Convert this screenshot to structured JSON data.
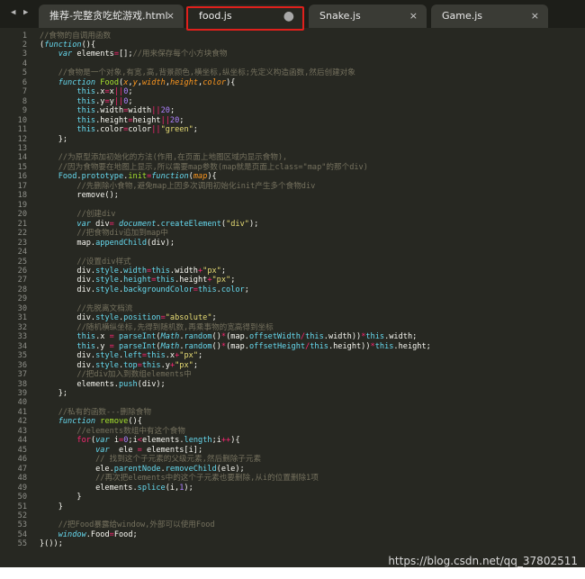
{
  "tabs": [
    {
      "label": "推荐-完整贪吃蛇游戏.html",
      "marker": "×",
      "active": false
    },
    {
      "label": "food.js",
      "marker": "●",
      "active": true
    },
    {
      "label": "Snake.js",
      "marker": "×",
      "active": false
    },
    {
      "label": "Game.js",
      "marker": "×",
      "active": false
    }
  ],
  "nav": {
    "back": "◀",
    "forward": "▶"
  },
  "line_numbers": [
    "1",
    "2",
    "3",
    "4",
    "5",
    "6",
    "7",
    "8",
    "9",
    "10",
    "11",
    "12",
    "13",
    "14",
    "15",
    "16",
    "17",
    "18",
    "19",
    "20",
    "21",
    "22",
    "23",
    "24",
    "25",
    "26",
    "27",
    "28",
    "29",
    "30",
    "31",
    "32",
    "33",
    "34",
    "35",
    "36",
    "37",
    "38",
    "39",
    "40",
    "41",
    "42",
    "43",
    "44",
    "45",
    "46",
    "47",
    "48",
    "49",
    "50",
    "51",
    "52",
    "53",
    "54",
    "55"
  ],
  "code": [
    [
      {
        "t": "//食物的自调用函数",
        "c": "c"
      }
    ],
    [
      {
        "t": "(",
        "c": ""
      },
      {
        "t": "function",
        "c": "k"
      },
      {
        "t": "(){",
        "c": ""
      }
    ],
    [
      {
        "t": "    ",
        "c": ""
      },
      {
        "t": "var",
        "c": "k"
      },
      {
        "t": " elements",
        "c": ""
      },
      {
        "t": "=",
        "c": "o"
      },
      {
        "t": "[];",
        "c": ""
      },
      {
        "t": "//用来保存每个小方块食物",
        "c": "c"
      }
    ],
    [],
    [
      {
        "t": "    ",
        "c": ""
      },
      {
        "t": "//食物是一个对象,有宽,高,背景颜色,横坐标,纵坐标;先定义构造函数,然后创建对象",
        "c": "c"
      }
    ],
    [
      {
        "t": "    ",
        "c": ""
      },
      {
        "t": "function",
        "c": "k"
      },
      {
        "t": " ",
        "c": ""
      },
      {
        "t": "Food",
        "c": "f"
      },
      {
        "t": "(",
        "c": ""
      },
      {
        "t": "x",
        "c": "p"
      },
      {
        "t": ",",
        "c": ""
      },
      {
        "t": "y",
        "c": "p"
      },
      {
        "t": ",",
        "c": ""
      },
      {
        "t": "width",
        "c": "p"
      },
      {
        "t": ",",
        "c": ""
      },
      {
        "t": "height",
        "c": "p"
      },
      {
        "t": ",",
        "c": ""
      },
      {
        "t": "color",
        "c": "p"
      },
      {
        "t": "){",
        "c": ""
      }
    ],
    [
      {
        "t": "        ",
        "c": ""
      },
      {
        "t": "this",
        "c": "b"
      },
      {
        "t": ".x",
        "c": ""
      },
      {
        "t": "=",
        "c": "o"
      },
      {
        "t": "x",
        "c": ""
      },
      {
        "t": "||",
        "c": "o"
      },
      {
        "t": "0",
        "c": "n"
      },
      {
        "t": ";",
        "c": ""
      }
    ],
    [
      {
        "t": "        ",
        "c": ""
      },
      {
        "t": "this",
        "c": "b"
      },
      {
        "t": ".y",
        "c": ""
      },
      {
        "t": "=",
        "c": "o"
      },
      {
        "t": "y",
        "c": ""
      },
      {
        "t": "||",
        "c": "o"
      },
      {
        "t": "0",
        "c": "n"
      },
      {
        "t": ";",
        "c": ""
      }
    ],
    [
      {
        "t": "        ",
        "c": ""
      },
      {
        "t": "this",
        "c": "b"
      },
      {
        "t": ".width",
        "c": ""
      },
      {
        "t": "=",
        "c": "o"
      },
      {
        "t": "width",
        "c": ""
      },
      {
        "t": "||",
        "c": "o"
      },
      {
        "t": "20",
        "c": "n"
      },
      {
        "t": ";",
        "c": ""
      }
    ],
    [
      {
        "t": "        ",
        "c": ""
      },
      {
        "t": "this",
        "c": "b"
      },
      {
        "t": ".height",
        "c": ""
      },
      {
        "t": "=",
        "c": "o"
      },
      {
        "t": "height",
        "c": ""
      },
      {
        "t": "||",
        "c": "o"
      },
      {
        "t": "20",
        "c": "n"
      },
      {
        "t": ";",
        "c": ""
      }
    ],
    [
      {
        "t": "        ",
        "c": ""
      },
      {
        "t": "this",
        "c": "b"
      },
      {
        "t": ".color",
        "c": ""
      },
      {
        "t": "=",
        "c": "o"
      },
      {
        "t": "color",
        "c": ""
      },
      {
        "t": "||",
        "c": "o"
      },
      {
        "t": "\"green\"",
        "c": "s"
      },
      {
        "t": ";",
        "c": ""
      }
    ],
    [
      {
        "t": "    };",
        "c": ""
      }
    ],
    [],
    [
      {
        "t": "    ",
        "c": ""
      },
      {
        "t": "//为原型添加初始化的方法(作用,在页面上地图区域内显示食物),",
        "c": "c"
      }
    ],
    [
      {
        "t": "    ",
        "c": ""
      },
      {
        "t": "//因为食物要在地图上显示,所以需要map参数(map就是页面上class=\"map\"的那个div)",
        "c": "c"
      }
    ],
    [
      {
        "t": "    ",
        "c": ""
      },
      {
        "t": "Food",
        "c": "b"
      },
      {
        "t": ".",
        "c": ""
      },
      {
        "t": "prototype",
        "c": "b"
      },
      {
        "t": ".",
        "c": ""
      },
      {
        "t": "init",
        "c": "f"
      },
      {
        "t": "=",
        "c": "o"
      },
      {
        "t": "function",
        "c": "k"
      },
      {
        "t": "(",
        "c": ""
      },
      {
        "t": "map",
        "c": "p"
      },
      {
        "t": "){",
        "c": ""
      }
    ],
    [
      {
        "t": "        ",
        "c": ""
      },
      {
        "t": "//先删除小食物,避免map上因多次调用初始化init产生多个食物div",
        "c": "c"
      }
    ],
    [
      {
        "t": "        remove();",
        "c": ""
      }
    ],
    [],
    [
      {
        "t": "        ",
        "c": ""
      },
      {
        "t": "//创建div",
        "c": "c"
      }
    ],
    [
      {
        "t": "        ",
        "c": ""
      },
      {
        "t": "var",
        "c": "k"
      },
      {
        "t": " div",
        "c": ""
      },
      {
        "t": "=",
        "c": "o"
      },
      {
        "t": " ",
        "c": ""
      },
      {
        "t": "document",
        "c": "k"
      },
      {
        "t": ".",
        "c": ""
      },
      {
        "t": "createElement",
        "c": "b"
      },
      {
        "t": "(",
        "c": ""
      },
      {
        "t": "\"div\"",
        "c": "s"
      },
      {
        "t": ");",
        "c": ""
      }
    ],
    [
      {
        "t": "        ",
        "c": ""
      },
      {
        "t": "//把食物div追加到map中",
        "c": "c"
      }
    ],
    [
      {
        "t": "        map.",
        "c": ""
      },
      {
        "t": "appendChild",
        "c": "b"
      },
      {
        "t": "(div);",
        "c": ""
      }
    ],
    [],
    [
      {
        "t": "        ",
        "c": ""
      },
      {
        "t": "//设置div样式",
        "c": "c"
      }
    ],
    [
      {
        "t": "        div.",
        "c": ""
      },
      {
        "t": "style",
        "c": "b"
      },
      {
        "t": ".",
        "c": ""
      },
      {
        "t": "width",
        "c": "b"
      },
      {
        "t": "=",
        "c": "o"
      },
      {
        "t": "this",
        "c": "b"
      },
      {
        "t": ".width",
        "c": ""
      },
      {
        "t": "+",
        "c": "o"
      },
      {
        "t": "\"px\"",
        "c": "s"
      },
      {
        "t": ";",
        "c": ""
      }
    ],
    [
      {
        "t": "        div.",
        "c": ""
      },
      {
        "t": "style",
        "c": "b"
      },
      {
        "t": ".",
        "c": ""
      },
      {
        "t": "height",
        "c": "b"
      },
      {
        "t": "=",
        "c": "o"
      },
      {
        "t": "this",
        "c": "b"
      },
      {
        "t": ".height",
        "c": ""
      },
      {
        "t": "+",
        "c": "o"
      },
      {
        "t": "\"px\"",
        "c": "s"
      },
      {
        "t": ";",
        "c": ""
      }
    ],
    [
      {
        "t": "        div.",
        "c": ""
      },
      {
        "t": "style",
        "c": "b"
      },
      {
        "t": ".",
        "c": ""
      },
      {
        "t": "backgroundColor",
        "c": "b"
      },
      {
        "t": "=",
        "c": "o"
      },
      {
        "t": "this",
        "c": "b"
      },
      {
        "t": ".",
        "c": ""
      },
      {
        "t": "color",
        "c": "b"
      },
      {
        "t": ";",
        "c": ""
      }
    ],
    [],
    [
      {
        "t": "        ",
        "c": ""
      },
      {
        "t": "//先脱离文档流",
        "c": "c"
      }
    ],
    [
      {
        "t": "        div.",
        "c": ""
      },
      {
        "t": "style",
        "c": "b"
      },
      {
        "t": ".",
        "c": ""
      },
      {
        "t": "position",
        "c": "b"
      },
      {
        "t": "=",
        "c": "o"
      },
      {
        "t": "\"absolute\"",
        "c": "s"
      },
      {
        "t": ";",
        "c": ""
      }
    ],
    [
      {
        "t": "        ",
        "c": ""
      },
      {
        "t": "//随机横纵坐标,先得到随机数,再乘事物的宽高得到坐标",
        "c": "c"
      }
    ],
    [
      {
        "t": "        ",
        "c": ""
      },
      {
        "t": "this",
        "c": "b"
      },
      {
        "t": ".x ",
        "c": ""
      },
      {
        "t": "=",
        "c": "o"
      },
      {
        "t": " ",
        "c": ""
      },
      {
        "t": "parseInt",
        "c": "b"
      },
      {
        "t": "(",
        "c": ""
      },
      {
        "t": "Math",
        "c": "k"
      },
      {
        "t": ".",
        "c": ""
      },
      {
        "t": "random",
        "c": "b"
      },
      {
        "t": "()",
        "c": ""
      },
      {
        "t": "*",
        "c": "o"
      },
      {
        "t": "(map.",
        "c": ""
      },
      {
        "t": "offsetWidth",
        "c": "b"
      },
      {
        "t": "/",
        "c": "o"
      },
      {
        "t": "this",
        "c": "b"
      },
      {
        "t": ".width))",
        "c": ""
      },
      {
        "t": "*",
        "c": "o"
      },
      {
        "t": "this",
        "c": "b"
      },
      {
        "t": ".width;",
        "c": ""
      }
    ],
    [
      {
        "t": "        ",
        "c": ""
      },
      {
        "t": "this",
        "c": "b"
      },
      {
        "t": ".y ",
        "c": ""
      },
      {
        "t": "=",
        "c": "o"
      },
      {
        "t": " ",
        "c": ""
      },
      {
        "t": "parseInt",
        "c": "b"
      },
      {
        "t": "(",
        "c": ""
      },
      {
        "t": "Math",
        "c": "k"
      },
      {
        "t": ".",
        "c": ""
      },
      {
        "t": "random",
        "c": "b"
      },
      {
        "t": "()",
        "c": ""
      },
      {
        "t": "*",
        "c": "o"
      },
      {
        "t": "(map.",
        "c": ""
      },
      {
        "t": "offsetHeight",
        "c": "b"
      },
      {
        "t": "/",
        "c": "o"
      },
      {
        "t": "this",
        "c": "b"
      },
      {
        "t": ".height))",
        "c": ""
      },
      {
        "t": "*",
        "c": "o"
      },
      {
        "t": "this",
        "c": "b"
      },
      {
        "t": ".height;",
        "c": ""
      }
    ],
    [
      {
        "t": "        div.",
        "c": ""
      },
      {
        "t": "style",
        "c": "b"
      },
      {
        "t": ".",
        "c": ""
      },
      {
        "t": "left",
        "c": "b"
      },
      {
        "t": "=",
        "c": "o"
      },
      {
        "t": "this",
        "c": "b"
      },
      {
        "t": ".x",
        "c": ""
      },
      {
        "t": "+",
        "c": "o"
      },
      {
        "t": "\"px\"",
        "c": "s"
      },
      {
        "t": ";",
        "c": ""
      }
    ],
    [
      {
        "t": "        div.",
        "c": ""
      },
      {
        "t": "style",
        "c": "b"
      },
      {
        "t": ".",
        "c": ""
      },
      {
        "t": "top",
        "c": "b"
      },
      {
        "t": "=",
        "c": "o"
      },
      {
        "t": "this",
        "c": "b"
      },
      {
        "t": ".y",
        "c": ""
      },
      {
        "t": "+",
        "c": "o"
      },
      {
        "t": "\"px\"",
        "c": "s"
      },
      {
        "t": ";",
        "c": ""
      }
    ],
    [
      {
        "t": "        ",
        "c": ""
      },
      {
        "t": "//把div加入到数组elements中",
        "c": "c"
      }
    ],
    [
      {
        "t": "        elements.",
        "c": ""
      },
      {
        "t": "push",
        "c": "b"
      },
      {
        "t": "(div);",
        "c": ""
      }
    ],
    [
      {
        "t": "    };",
        "c": ""
      }
    ],
    [],
    [
      {
        "t": "    ",
        "c": ""
      },
      {
        "t": "//私有的函数---删除食物",
        "c": "c"
      }
    ],
    [
      {
        "t": "    ",
        "c": ""
      },
      {
        "t": "function",
        "c": "k"
      },
      {
        "t": " ",
        "c": ""
      },
      {
        "t": "remove",
        "c": "f"
      },
      {
        "t": "(){",
        "c": ""
      }
    ],
    [
      {
        "t": "        ",
        "c": ""
      },
      {
        "t": "//elements数组中有这个食物",
        "c": "c"
      }
    ],
    [
      {
        "t": "        ",
        "c": ""
      },
      {
        "t": "for",
        "c": "o"
      },
      {
        "t": "(",
        "c": ""
      },
      {
        "t": "var",
        "c": "k"
      },
      {
        "t": " i",
        "c": ""
      },
      {
        "t": "=",
        "c": "o"
      },
      {
        "t": "0",
        "c": "n"
      },
      {
        "t": ";i",
        "c": ""
      },
      {
        "t": "<",
        "c": "o"
      },
      {
        "t": "elements.",
        "c": ""
      },
      {
        "t": "length",
        "c": "b"
      },
      {
        "t": ";i",
        "c": ""
      },
      {
        "t": "++",
        "c": "o"
      },
      {
        "t": "){",
        "c": ""
      }
    ],
    [
      {
        "t": "            ",
        "c": ""
      },
      {
        "t": "var",
        "c": "k"
      },
      {
        "t": "  ele ",
        "c": ""
      },
      {
        "t": "=",
        "c": "o"
      },
      {
        "t": " elements[i];",
        "c": ""
      }
    ],
    [
      {
        "t": "            ",
        "c": ""
      },
      {
        "t": "// 找到这个子元素的父级元素,然后删除子元素",
        "c": "c"
      }
    ],
    [
      {
        "t": "            ele.",
        "c": ""
      },
      {
        "t": "parentNode",
        "c": "b"
      },
      {
        "t": ".",
        "c": ""
      },
      {
        "t": "removeChild",
        "c": "b"
      },
      {
        "t": "(ele);",
        "c": ""
      }
    ],
    [
      {
        "t": "            ",
        "c": ""
      },
      {
        "t": "//再次把elements中的这个子元素也要删除,从i的位置删除1项",
        "c": "c"
      }
    ],
    [
      {
        "t": "            elements.",
        "c": ""
      },
      {
        "t": "splice",
        "c": "b"
      },
      {
        "t": "(i,",
        "c": ""
      },
      {
        "t": "1",
        "c": "n"
      },
      {
        "t": ");",
        "c": ""
      }
    ],
    [
      {
        "t": "        }",
        "c": ""
      }
    ],
    [
      {
        "t": "    }",
        "c": ""
      }
    ],
    [],
    [
      {
        "t": "    ",
        "c": ""
      },
      {
        "t": "//把Food暴露给window,外部可以使用Food",
        "c": "c"
      }
    ],
    [
      {
        "t": "    ",
        "c": ""
      },
      {
        "t": "window",
        "c": "k"
      },
      {
        "t": ".Food",
        "c": ""
      },
      {
        "t": "=",
        "c": "o"
      },
      {
        "t": "Food;",
        "c": ""
      }
    ],
    [
      {
        "t": "}());",
        "c": ""
      }
    ]
  ],
  "watermark": "https://blog.csdn.net/qq_37802511"
}
